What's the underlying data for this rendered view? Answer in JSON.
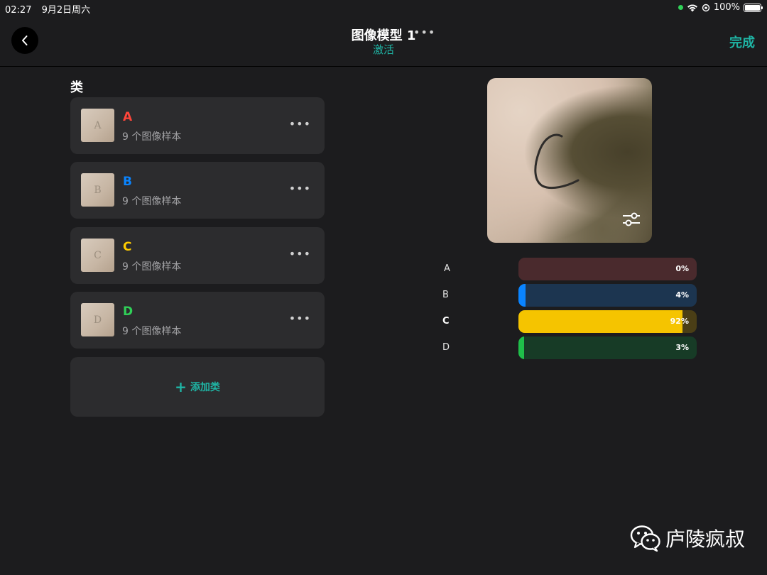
{
  "status_bar": {
    "time": "02:27",
    "date": "9月2日周六",
    "battery": "100%"
  },
  "nav": {
    "title": "图像模型 1",
    "subtitle": "激活",
    "done_label": "完成"
  },
  "classes_section": {
    "title": "类"
  },
  "classes": [
    {
      "letter": "A",
      "name": "A",
      "count": "9 个图像样本",
      "color": "#ff453a"
    },
    {
      "letter": "B",
      "name": "B",
      "count": "9 个图像样本",
      "color": "#0a84ff"
    },
    {
      "letter": "C",
      "name": "C",
      "count": "9 个图像样本",
      "color": "#ffcc00"
    },
    {
      "letter": "D",
      "name": "D",
      "count": "9 个图像样本",
      "color": "#30d158"
    }
  ],
  "add_class": {
    "label": "添加类"
  },
  "preview": {
    "icon": "sliders-icon"
  },
  "predictions": [
    {
      "label": "A",
      "value": 0,
      "pct": "0%",
      "track": "#4a2a2d",
      "fill": "#ff453a"
    },
    {
      "label": "B",
      "value": 4,
      "pct": "4%",
      "track": "#1c3550",
      "fill": "#0a84ff"
    },
    {
      "label": "C",
      "value": 92,
      "pct": "92%",
      "track": "#4a3e16",
      "fill": "#f5c400"
    },
    {
      "label": "D",
      "value": 3,
      "pct": "3%",
      "track": "#173b26",
      "fill": "#1fbe4a"
    }
  ],
  "watermark": {
    "text": "庐陵疯叔"
  }
}
